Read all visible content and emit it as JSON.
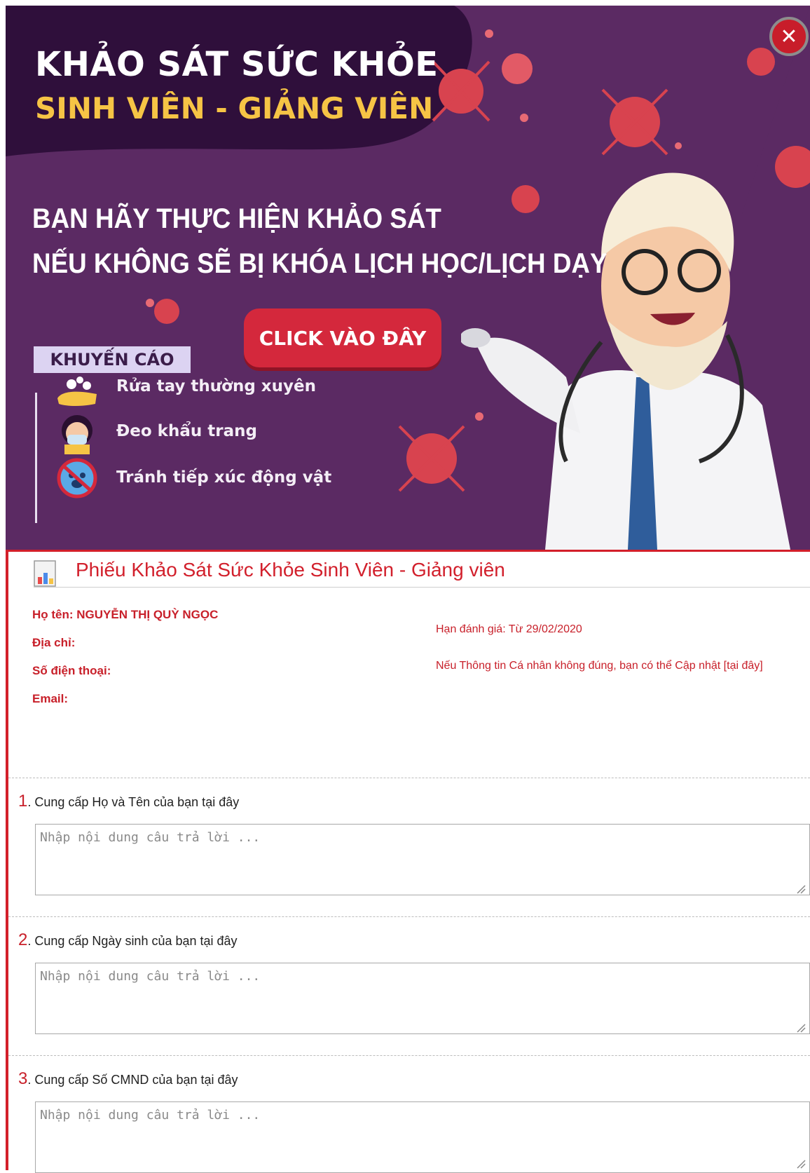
{
  "banner": {
    "title_line1": "KHẢO SÁT SỨC KHỎE",
    "title_line2": "SINH VIÊN - GIẢNG VIÊN",
    "message_line1": "BẠN HÃY THỰC HIỆN KHẢO SÁT",
    "message_line2": "NẾU KHÔNG SẼ BỊ KHÓA LỊCH HỌC/LỊCH DẠY",
    "cta_label": "CLICK VÀO ĐÂY",
    "tips_label": "KHUYẾN CÁO",
    "tips": [
      {
        "icon": "hand-wash-icon",
        "text": "Rửa tay thường xuyên"
      },
      {
        "icon": "face-mask-icon",
        "text": "Đeo khẩu trang"
      },
      {
        "icon": "no-animal-icon",
        "text": "Tránh tiếp xúc động vật"
      }
    ],
    "close_label": "✕",
    "colors": {
      "background": "#5b2a63",
      "accent": "#d4283c",
      "title_yellow": "#f6c445"
    }
  },
  "form": {
    "title": "Phiếu Khảo Sát Sức Khỏe Sinh Viên - Giảng viên",
    "info": {
      "name": "Họ tên: NGUYỄN THỊ QUỲ NGỌC",
      "address": "Địa chỉ:",
      "phone": "Số điện thoại:",
      "email": "Email:",
      "deadline": "Hạn đánh giá: Từ 29/02/2020",
      "update_note": "Nếu Thông tin Cá nhân không đúng, bạn có thể Cập nhật [tại đây]"
    },
    "questions": [
      {
        "number": "1",
        "label": ". Cung cấp Họ và Tên của bạn tại đây",
        "placeholder": "Nhập nội dung câu trả lời ..."
      },
      {
        "number": "2",
        "label": ". Cung cấp Ngày sinh của bạn tại đây",
        "placeholder": "Nhập nội dung câu trả lời ..."
      },
      {
        "number": "3",
        "label": ". Cung cấp Số CMND của bạn tại đây",
        "placeholder": "Nhập nội dung câu trả lời ..."
      }
    ]
  }
}
